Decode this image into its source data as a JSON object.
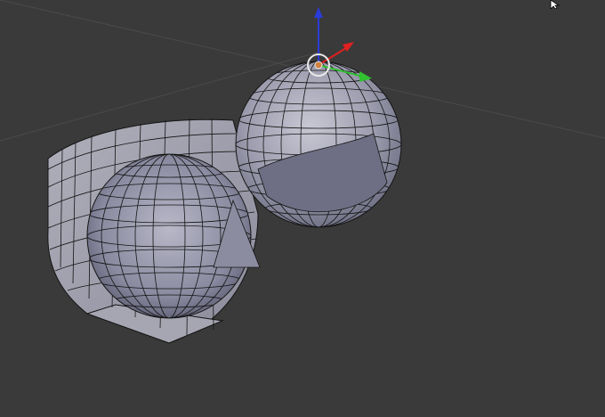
{
  "viewport": {
    "background_color": "#3a3a3a",
    "grid_line_color": "#4a4a4a"
  },
  "objects": [
    {
      "name": "quarter-hemisphere-shell",
      "selected": false
    },
    {
      "name": "inner-sphere",
      "selected": false
    },
    {
      "name": "cut-sphere",
      "selected": false
    }
  ],
  "manipulator": {
    "z_axis_color": "#2a3cd8",
    "x_axis_color": "#e02020",
    "y_axis_color": "#30c030",
    "origin_ring_color": "#e8e8e8",
    "origin_fill_color": "#d08040"
  },
  "mesh": {
    "face_color": "#9898a8",
    "edge_color": "#141414",
    "vertex_color": "#000000"
  },
  "icons": [
    "cursor-arrow-icon",
    "transform-manipulator-icon",
    "object-origin-icon"
  ]
}
